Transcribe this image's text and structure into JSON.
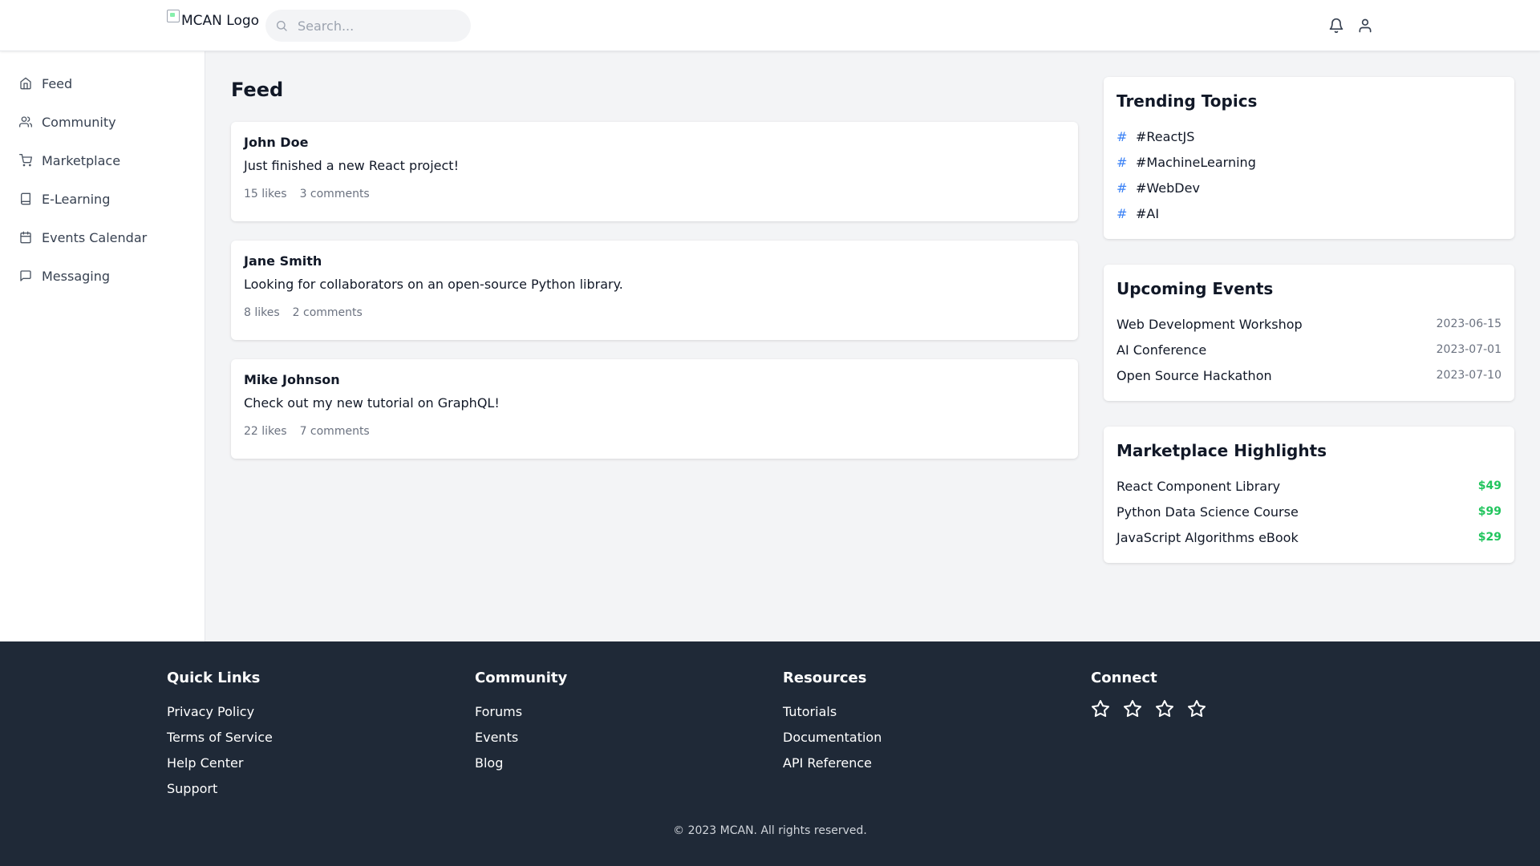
{
  "header": {
    "logo_alt": "MCAN Logo",
    "search_placeholder": "Search...",
    "search_icon": "search-icon",
    "notifications_icon": "bell-icon",
    "profile_icon": "user-icon"
  },
  "sidebar": {
    "items": [
      {
        "label": "Feed",
        "icon": "home-icon"
      },
      {
        "label": "Community",
        "icon": "users-icon"
      },
      {
        "label": "Marketplace",
        "icon": "cart-icon"
      },
      {
        "label": "E-Learning",
        "icon": "book-icon"
      },
      {
        "label": "Events Calendar",
        "icon": "calendar-icon"
      },
      {
        "label": "Messaging",
        "icon": "message-icon"
      }
    ]
  },
  "main": {
    "title": "Feed",
    "posts": [
      {
        "author": "John Doe",
        "text": "Just finished a new React project!",
        "likes": "15 likes",
        "comments": "3 comments"
      },
      {
        "author": "Jane Smith",
        "text": "Looking for collaborators on an open-source Python library.",
        "likes": "8 likes",
        "comments": "2 comments"
      },
      {
        "author": "Mike Johnson",
        "text": "Check out my new tutorial on GraphQL!",
        "likes": "22 likes",
        "comments": "7 comments"
      }
    ]
  },
  "trending": {
    "title": "Trending Topics",
    "topics": [
      "#ReactJS",
      "#MachineLearning",
      "#WebDev",
      "#AI"
    ]
  },
  "events": {
    "title": "Upcoming Events",
    "items": [
      {
        "name": "Web Development Workshop",
        "date": "2023-06-15"
      },
      {
        "name": "AI Conference",
        "date": "2023-07-01"
      },
      {
        "name": "Open Source Hackathon",
        "date": "2023-07-10"
      }
    ]
  },
  "marketplace": {
    "title": "Marketplace Highlights",
    "items": [
      {
        "name": "React Component Library",
        "price": "$49"
      },
      {
        "name": "Python Data Science Course",
        "price": "$99"
      },
      {
        "name": "JavaScript Algorithms eBook",
        "price": "$29"
      }
    ]
  },
  "footer": {
    "columns": [
      {
        "title": "Quick Links",
        "links": [
          "Privacy Policy",
          "Terms of Service",
          "Help Center",
          "Support"
        ]
      },
      {
        "title": "Community",
        "links": [
          "Forums",
          "Events",
          "Blog"
        ]
      },
      {
        "title": "Resources",
        "links": [
          "Tutorials",
          "Documentation",
          "API Reference"
        ]
      }
    ],
    "connect": {
      "title": "Connect",
      "icons": [
        "star-icon",
        "star-icon",
        "star-icon",
        "star-icon"
      ]
    },
    "copyright": "© 2023 MCAN. All rights reserved."
  },
  "colors": {
    "accent": "#3b82f6",
    "price": "#22c55e",
    "footer_bg": "#1f2937",
    "page_bg": "#f3f4f6"
  }
}
